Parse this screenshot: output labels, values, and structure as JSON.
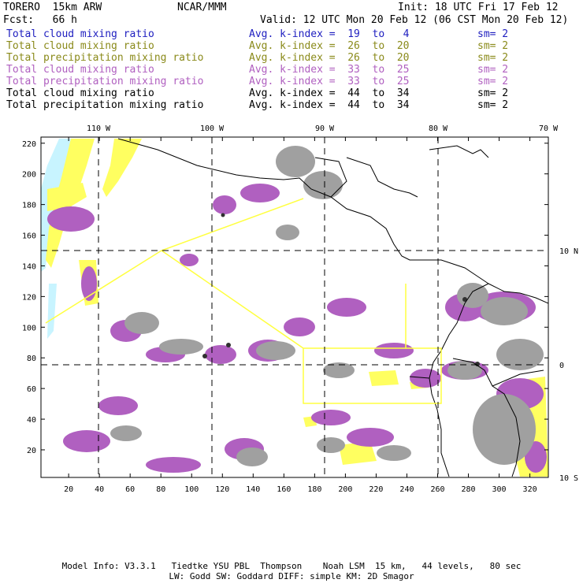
{
  "header": {
    "title_left": "TORERO  15km ARW",
    "title_center": "NCAR/MMM",
    "init": "Init: 18 UTC Fri 17 Feb 12",
    "fcst": "Fcst:   66 h",
    "valid": "Valid: 12 UTC Mon 20 Feb 12 (06 CST Mon 20 Feb 12)"
  },
  "legend": [
    {
      "field": "Total cloud mixing ratio",
      "kidx": "Avg. k-index =  19  to   4",
      "sm": "sm= 2",
      "color": "#2020c0"
    },
    {
      "field": "Total cloud mixing ratio",
      "kidx": "Avg. k-index =  26  to  20",
      "sm": "sm= 2",
      "color": "#8a8a1a"
    },
    {
      "field": "Total precipitation mixing ratio",
      "kidx": "Avg. k-index =  26  to  20",
      "sm": "sm= 2",
      "color": "#8a8a1a"
    },
    {
      "field": "Total cloud mixing ratio",
      "kidx": "Avg. k-index =  33  to  25",
      "sm": "sm= 2",
      "color": "#b060c0"
    },
    {
      "field": "Total precipitation mixing ratio",
      "kidx": "Avg. k-index =  33  to  25",
      "sm": "sm= 2",
      "color": "#b060c0"
    },
    {
      "field": "Total cloud mixing ratio",
      "kidx": "Avg. k-index =  44  to  34",
      "sm": "sm= 2",
      "color": "#000000"
    },
    {
      "field": "Total precipitation mixing ratio",
      "kidx": "Avg. k-index =  44  to  34",
      "sm": "sm= 2",
      "color": "#000000"
    }
  ],
  "map": {
    "lon_labels": [
      "110 W",
      "100 W",
      "90 W",
      "80 W",
      "70 W"
    ],
    "lat_labels": [
      "10 N",
      "0",
      "10 S"
    ],
    "x_ticks": [
      "20",
      "40",
      "60",
      "80",
      "100",
      "120",
      "140",
      "160",
      "180",
      "200",
      "220",
      "240",
      "260",
      "280",
      "300",
      "320"
    ],
    "y_ticks": [
      "20",
      "40",
      "60",
      "80",
      "100",
      "120",
      "140",
      "160",
      "180",
      "200",
      "220"
    ],
    "colors": {
      "gray": "#a0a0a0",
      "purple": "#b060c0",
      "yellow": "#ffff60",
      "cyan": "#c8f4ff",
      "box": "#ffff40"
    }
  },
  "footer": {
    "line1": "Model Info: V3.3.1   Tiedtke YSU PBL  Thompson    Noah LSM  15 km,   44 levels,   80 sec",
    "line2": "LW: Godd SW: Goddard DIFF: simple KM: 2D Smagor"
  }
}
